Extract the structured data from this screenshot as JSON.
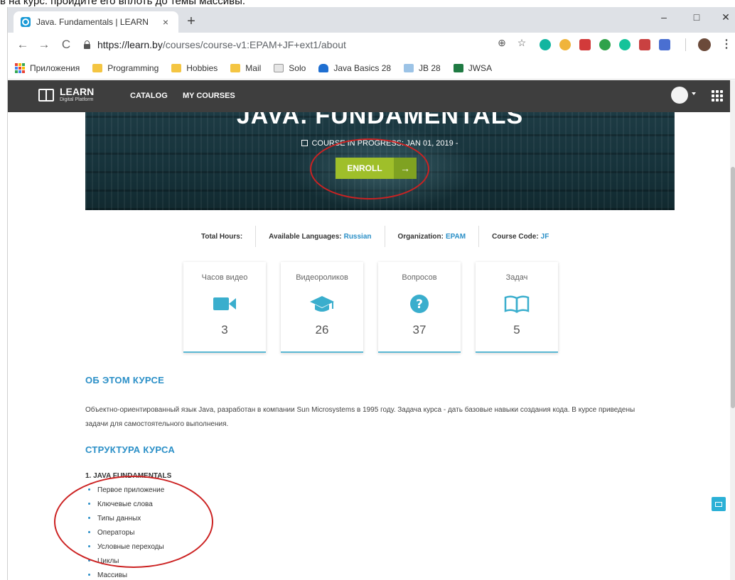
{
  "caption": "в на курс: пройдите его вплоть до темы массивы.",
  "browser": {
    "tab_title": "Java. Fundamentals | LEARN",
    "tab_close": "×",
    "new_tab": "+",
    "window_min": "–",
    "window_max": "□",
    "window_close": "✕",
    "back": "←",
    "forward": "→",
    "reload": "C",
    "url_host": "https://learn.by",
    "url_path": "/courses/course-v1:EPAM+JF+ext1/about",
    "zoom_icon": "⊕",
    "star_icon": "☆",
    "menu": "⋮",
    "bookmarks": [
      {
        "label": "Приложения",
        "icon": "apps-icon"
      },
      {
        "label": "Programming",
        "icon": "folder-icon"
      },
      {
        "label": "Hobbies",
        "icon": "folder-icon"
      },
      {
        "label": "Mail",
        "icon": "folder-icon"
      },
      {
        "label": "Solo",
        "icon": "c-icon"
      },
      {
        "label": "Java Basics 28",
        "icon": "cloud-icon"
      },
      {
        "label": "JB 28",
        "icon": "board-icon"
      },
      {
        "label": "JWSA",
        "icon": "excel-icon"
      }
    ],
    "colors": {
      "folder": "#f4c542",
      "cloud": "#1f6fd1",
      "excel": "#1f7a43",
      "tabbar": "#dee1e6"
    }
  },
  "site": {
    "logo_title": "LEARN",
    "logo_subtitle": "Digital Platform",
    "nav": [
      "CATALOG",
      "MY COURSES"
    ],
    "hero_title": "JAVA. FUNDAMENTALS",
    "hero_meta": "COURSE IN PROGRESS: JAN 01, 2019 -",
    "enroll_label": "ENROLL",
    "enroll_arrow": "→",
    "info": {
      "total_hours_label": "Total Hours:",
      "languages_label": "Available Languages:",
      "languages_value": "Russian",
      "organization_label": "Organization:",
      "organization_value": "EPAM",
      "code_label": "Course Code:",
      "code_value": "JF"
    },
    "stats": [
      {
        "label": "Часов видео",
        "value": "3",
        "icon": "video-camera-icon"
      },
      {
        "label": "Видеороликов",
        "value": "26",
        "icon": "graduation-cap-icon"
      },
      {
        "label": "Вопросов",
        "value": "37",
        "icon": "question-circle-icon"
      },
      {
        "label": "Задач",
        "value": "5",
        "icon": "open-book-icon"
      }
    ],
    "about_title": "ОБ ЭТОМ КУРСЕ",
    "about_text": "Объектно-ориентированный язык Java, разработан в компании Sun Microsystems в 1995 году. Задача курса - дать базовые навыки создания кода. В курсе приведены задачи для самостоятельного выполнения.",
    "structure_title": "СТРУКТУРА КУРСА",
    "module_title": "1. JAVA FUNDAMENTALS",
    "lessons": [
      "Первое приложение",
      "Ключевые слова",
      "Типы данных",
      "Операторы",
      "Условные переходы",
      "Циклы",
      "Массивы"
    ],
    "colors": {
      "accent": "#2a8fc7",
      "enroll": "#9fbf2a",
      "header": "#3e3e3e",
      "annotation": "#cc2222"
    }
  }
}
